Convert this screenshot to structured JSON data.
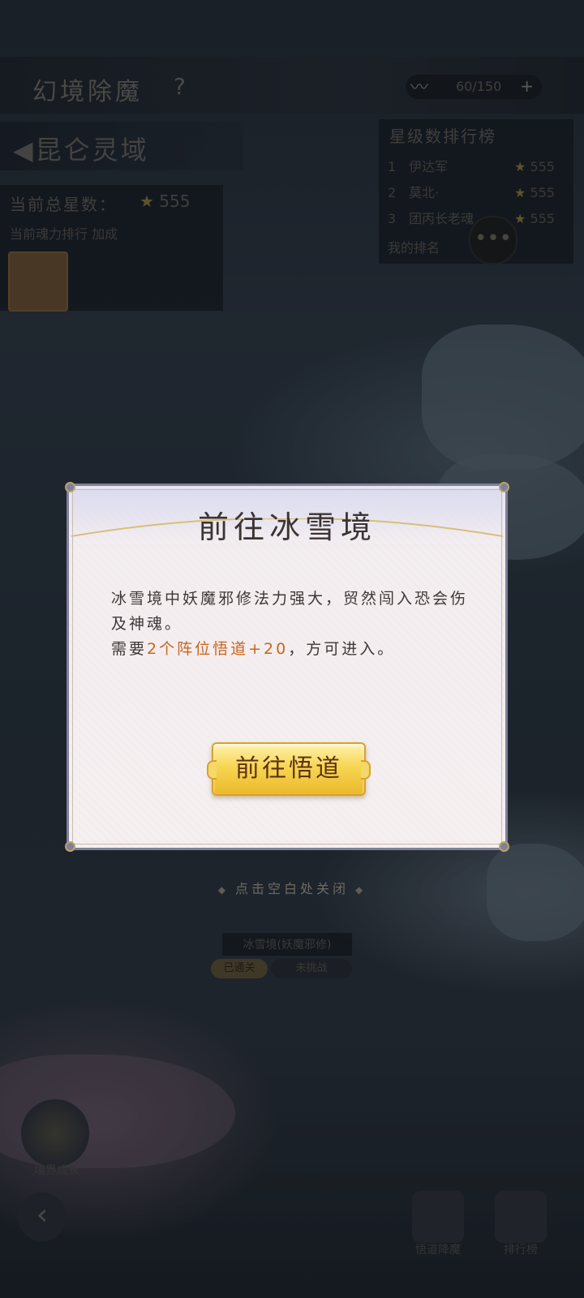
{
  "header": {
    "title": "幻境除魔",
    "help": "?",
    "resource_value": "60/150",
    "resource_plus": "+"
  },
  "region": {
    "name": "◀昆仑灵域",
    "stars_label": "当前总星数：",
    "stars_value": "555",
    "sub_label": "当前魂力排行 加成"
  },
  "ranking": {
    "title": "星级数排行榜",
    "rows": [
      {
        "rank": "1",
        "name": "伊达军",
        "stars": "555"
      },
      {
        "rank": "2",
        "name": "莫北·",
        "stars": "555"
      },
      {
        "rank": "3",
        "name": "团丙长老魂",
        "stars": "555"
      }
    ],
    "my_rank": "我的排名"
  },
  "stage": {
    "name": "冰雪境(妖魔邪修)",
    "tag1": "已通关",
    "tag2": "未挑战"
  },
  "bottom": {
    "left_label": "境界成长",
    "btn1_label": "悟道降魔",
    "btn2_label": "排行榜"
  },
  "overlay": {
    "close_hint": "点击空白处关闭"
  },
  "dialog": {
    "title": "前往冰雪境",
    "line1": "冰雪境中妖魔邪修法力强大，贸然闯入恐会伤及神魂。",
    "line2_prefix": "需要",
    "line2_highlight": "2个阵位悟道+20",
    "line2_suffix": "，方可进入。",
    "button_label": "前往悟道"
  },
  "colors": {
    "highlight": "#c8661c",
    "button_gold": "#f7d653",
    "dialog_border": "#7f8099"
  }
}
